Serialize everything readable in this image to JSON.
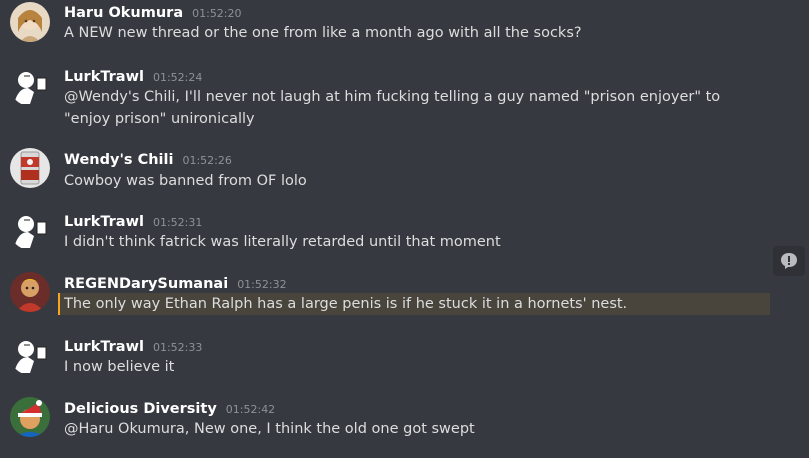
{
  "messages": [
    {
      "author": "Haru Okumura",
      "time": "01:52:20",
      "text": "A NEW new thread or the one from like a month ago with all the socks?",
      "avatar": "anime-girl-avatar"
    },
    {
      "author": "LurkTrawl",
      "time": "01:52:24",
      "text": "@Wendy's Chili, I'll never not laugh at him fucking telling a guy named \"prison enjoyer\" to \"enjoy prison\" unironically",
      "avatar": "drinking-man-avatar"
    },
    {
      "author": "Wendy's Chili",
      "time": "01:52:26",
      "text": "Cowboy was banned from OF lolo",
      "avatar": "chili-can-avatar"
    },
    {
      "author": "LurkTrawl",
      "time": "01:52:31",
      "text": "I didn't think fatrick was literally retarded until that moment",
      "avatar": "drinking-man-avatar"
    },
    {
      "author": "REGENDarySumanai",
      "time": "01:52:32",
      "text": "The only way Ethan Ralph has a large penis is if he stuck it in a hornets' nest.",
      "avatar": "character-avatar",
      "highlighted": true
    },
    {
      "author": "LurkTrawl",
      "time": "01:52:33",
      "text": "I now believe it",
      "avatar": "drinking-man-avatar"
    },
    {
      "author": "Delicious Diversity",
      "time": "01:52:42",
      "text": "@Haru Okumura, New one, I think the old one got swept",
      "avatar": "santa-hat-avatar"
    }
  ],
  "colors": {
    "background": "#36393f",
    "highlight": "#49443c",
    "accent": "#faa61a"
  }
}
